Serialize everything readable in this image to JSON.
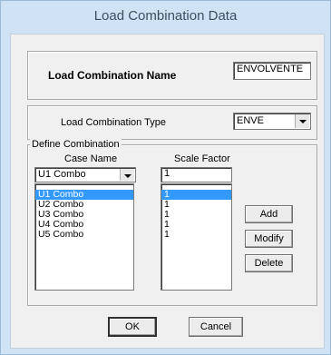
{
  "window": {
    "title": "Load Combination Data"
  },
  "name_section": {
    "label": "Load Combination Name",
    "value": "ENVOLVENTE"
  },
  "type_section": {
    "label": "Load Combination Type",
    "value": "ENVE"
  },
  "define": {
    "legend": "Define Combination",
    "col_case": "Case Name",
    "col_scale": "Scale Factor",
    "case_select": "U1 Combo",
    "scale_input": "1",
    "cases": [
      {
        "name": "U1 Combo",
        "factor": "1"
      },
      {
        "name": "U2 Combo",
        "factor": "1"
      },
      {
        "name": "U3 Combo",
        "factor": "1"
      },
      {
        "name": "U4 Combo",
        "factor": "1"
      },
      {
        "name": "U5 Combo",
        "factor": "1"
      }
    ],
    "selected_index": 0,
    "add": "Add",
    "modify": "Modify",
    "delete": "Delete"
  },
  "buttons": {
    "ok": "OK",
    "cancel": "Cancel"
  }
}
